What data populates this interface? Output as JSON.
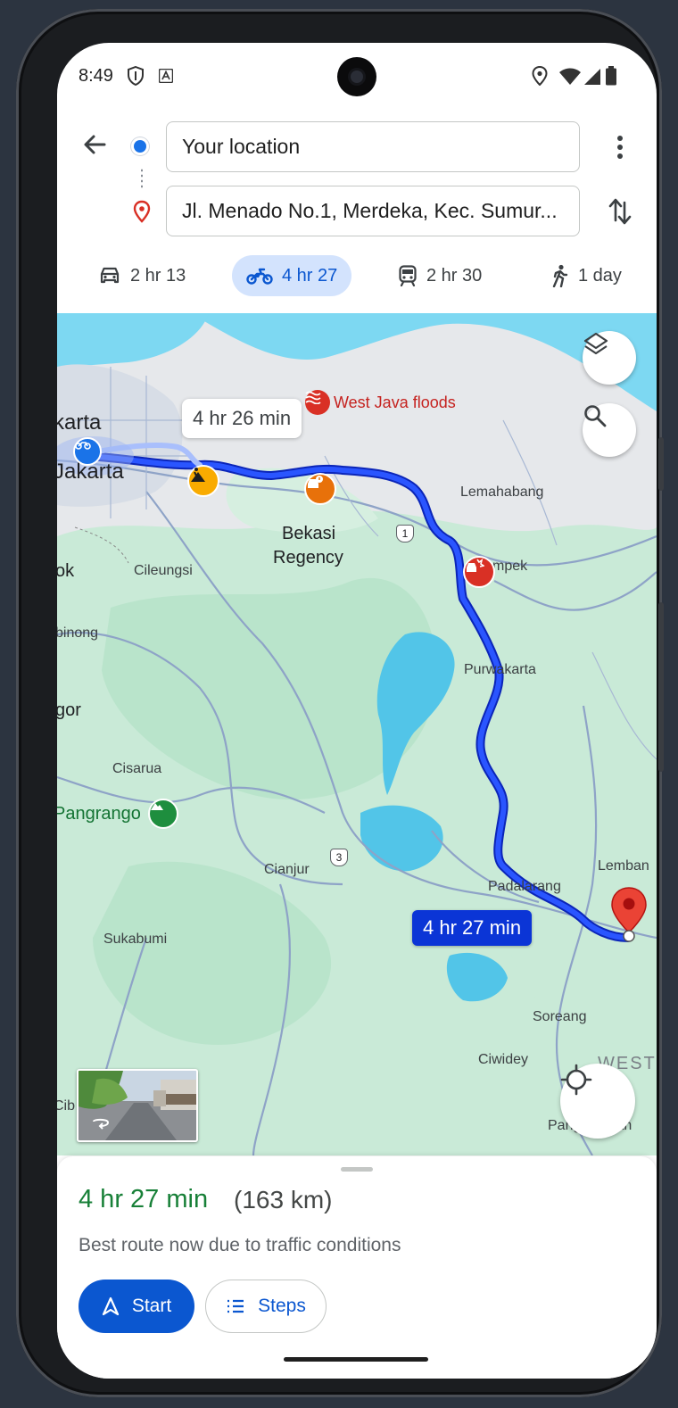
{
  "status_bar": {
    "time": "8:49"
  },
  "search": {
    "origin_value": "Your location",
    "destination_value": "Jl. Menado No.1, Merdeka, Kec. Sumur..."
  },
  "travel_modes": [
    {
      "icon": "car-icon",
      "label": "2 hr 13",
      "selected": false
    },
    {
      "icon": "motorcycle-icon",
      "label": "4 hr 27",
      "selected": true
    },
    {
      "icon": "train-icon",
      "label": "2 hr 30",
      "selected": false
    },
    {
      "icon": "walk-icon",
      "label": "1 day",
      "selected": false
    }
  ],
  "map": {
    "labels": {
      "jakarta_1": "karta",
      "jakarta_2": "Jakarta",
      "bekasi_1": "Bekasi",
      "bekasi_2": "Regency",
      "lemahabang": "Lemahabang",
      "jatisari": "mpek",
      "cileungsi": "Cileungsi",
      "depok": "ok",
      "cibinong": "binong",
      "bogor": "gor",
      "purwakarta": "Purwakarta",
      "cisarua": "Cisarua",
      "pangrango": "Pangrango",
      "cianjur": "Cianjur",
      "padalarang": "Padalarang",
      "lembang": "Lemban",
      "sukabumi": "Sukabumi",
      "soreang": "Soreang",
      "ciwidey": "Ciwidey",
      "west": "WEST",
      "pangalengan": "Pangalengan",
      "cibadak": "Cib",
      "road_1": "1",
      "road_3": "3"
    },
    "alert_label": "West Java floods",
    "alt_route_time": "4 hr 26 min",
    "main_route_time": "4 hr 27 min",
    "colors": {
      "route": "#1a3ef0",
      "water": "#7dd8f2",
      "green": "#bde6cf",
      "land": "#e6e8eb"
    }
  },
  "sheet": {
    "duration": "4 hr 27 min",
    "distance": "(163 km)",
    "subtitle": "Best route now due to traffic conditions",
    "start_label": "Start",
    "steps_label": "Steps"
  }
}
